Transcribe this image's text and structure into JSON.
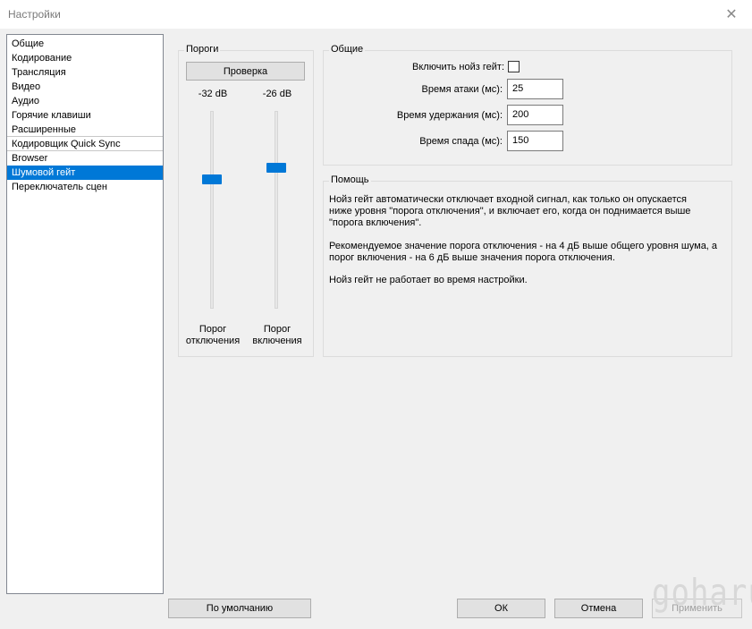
{
  "window": {
    "title": "Настройки",
    "close_glyph": "✕"
  },
  "sidebar": {
    "items": [
      {
        "label": "Общие"
      },
      {
        "label": "Кодирование"
      },
      {
        "label": "Трансляция"
      },
      {
        "label": "Видео"
      },
      {
        "label": "Аудио"
      },
      {
        "label": "Горячие клавиши"
      },
      {
        "label": "Расширенные"
      },
      {
        "label": "Кодировщик Quick Sync"
      },
      {
        "label": "Browser"
      },
      {
        "label": "Шумовой гейт",
        "selected": true
      },
      {
        "label": "Переключатель сцен"
      }
    ]
  },
  "thresholds": {
    "title": "Пороги",
    "test_button": "Проверка",
    "close_db": "-32 dB",
    "open_db": "-26 dB",
    "close_caption_1": "Порог",
    "close_caption_2": "отключения",
    "open_caption_1": "Порог",
    "open_caption_2": "включения"
  },
  "general": {
    "title": "Общие",
    "enable_label": "Включить нойз гейт:",
    "enable_checked": false,
    "attack_label": "Время атаки (мс):",
    "attack_value": "25",
    "hold_label": "Время удержания (мс):",
    "hold_value": "200",
    "release_label": "Время спада (мс):",
    "release_value": "150"
  },
  "help": {
    "title": "Помощь",
    "line1": "Нойз гейт автоматически отключает входной сигнал, как только он опускается",
    "line2": "ниже уровня \"порога отключения\", и включает его, когда он поднимается выше",
    "line3": "\"порога включения\".",
    "line4": "Рекомендуемое значение порога отключения - на 4 дБ выше общего уровня шума, а",
    "line5": "порог включения - на 6 дБ выше значения порога отключения.",
    "line6": "Нойз гейт не работает во время настройки."
  },
  "footer": {
    "defaults_button": "По умолчанию",
    "ok_button": "ОК",
    "cancel_button": "Отмена",
    "apply_button": "Применить"
  },
  "watermark": {
    "text": "goharu"
  },
  "colors": {
    "accent": "#0078d7"
  }
}
